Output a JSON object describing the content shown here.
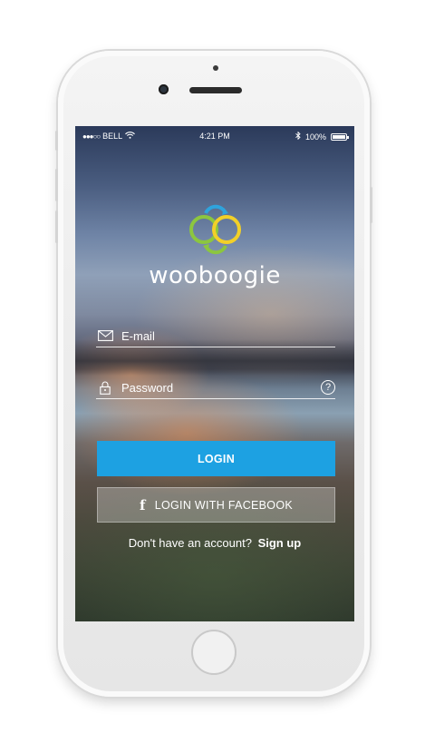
{
  "status_bar": {
    "signal_dots": "●●●○○",
    "carrier": "BELL",
    "time": "4:21 PM",
    "battery_percent": "100%"
  },
  "brand": {
    "name": "wooboogie",
    "logo_colors": [
      "#2fa3dc",
      "#8cc63f",
      "#f2d028"
    ]
  },
  "form": {
    "email_placeholder": "E-mail",
    "password_placeholder": "Password",
    "help_symbol": "?"
  },
  "buttons": {
    "login_label": "LOGIN",
    "login_color": "#1da1e2",
    "facebook_icon": "f",
    "facebook_label": "LOGIN WITH FACEBOOK"
  },
  "signup": {
    "prompt": "Don't have an account?",
    "link": "Sign up"
  },
  "icons": [
    "wifi-icon",
    "bluetooth-icon",
    "battery-icon",
    "envelope-icon",
    "lock-icon",
    "help-icon",
    "facebook-icon"
  ]
}
